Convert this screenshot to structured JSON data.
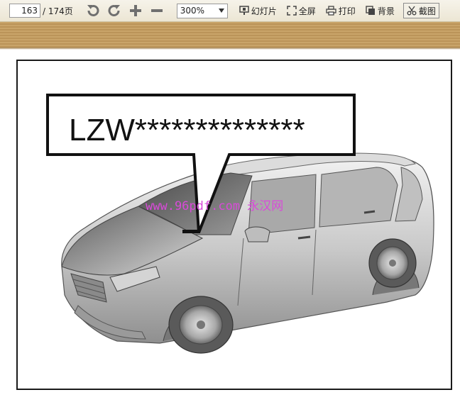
{
  "toolbar": {
    "page_current": "163",
    "page_total": "/ 174页",
    "zoom_value": "300%",
    "tools": {
      "slideshow": "幻灯片",
      "fullscreen": "全屏",
      "print": "打印",
      "background": "背景",
      "screenshot": "截图"
    },
    "icons": [
      "rotate-ccw-icon",
      "rotate-cw-icon",
      "zoom-in-icon",
      "zoom-out-icon",
      "slideshow-icon",
      "fullscreen-icon",
      "print-icon",
      "background-icon",
      "scissors-icon"
    ]
  },
  "document": {
    "callout_text": "LZW**************",
    "watermark": "www.96pdf.com 永汉网"
  },
  "colors": {
    "toolbar_bg": "#ece6d4",
    "band": "#c9a469",
    "watermark": "#d94ad9"
  }
}
